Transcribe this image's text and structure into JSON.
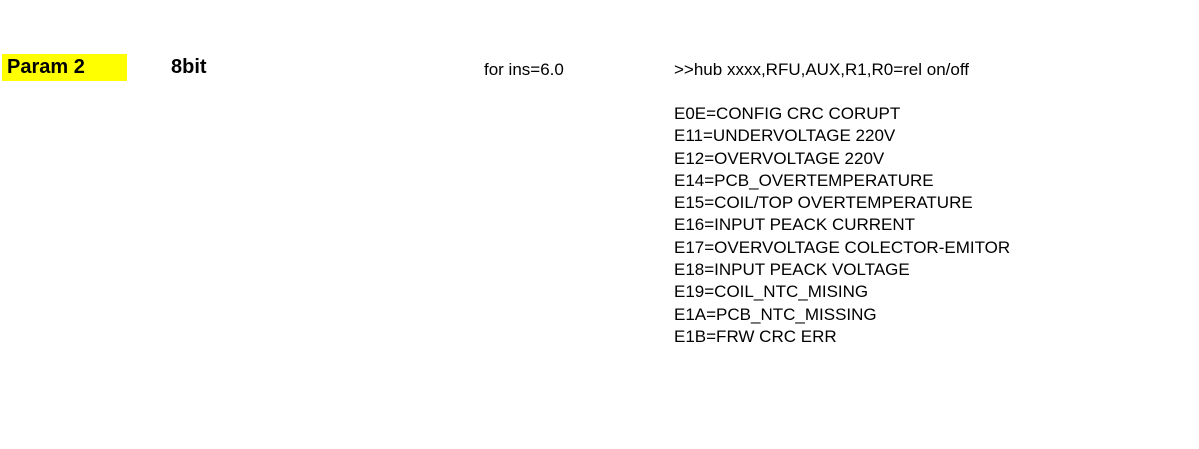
{
  "param": {
    "label": "Param 2",
    "bits": "8bit",
    "ins_note": "for ins=6.0",
    "hub_note": ">>hub xxxx,RFU,AUX,R1,R0=rel on/off"
  },
  "errors": [
    "E0E=CONFIG CRC CORUPT",
    "E11=UNDERVOLTAGE 220V",
    "E12=OVERVOLTAGE 220V",
    "E14=PCB_OVERTEMPERATURE",
    "E15=COIL/TOP OVERTEMPERATURE",
    "E16=INPUT PEACK CURRENT",
    "E17=OVERVOLTAGE COLECTOR-EMITOR",
    "E18=INPUT PEACK VOLTAGE",
    "E19=COIL_NTC_MISING",
    "E1A=PCB_NTC_MISSING",
    "E1B=FRW CRC ERR"
  ],
  "colors": {
    "highlight": "#ffff00",
    "text": "#000000",
    "background": "#ffffff"
  }
}
